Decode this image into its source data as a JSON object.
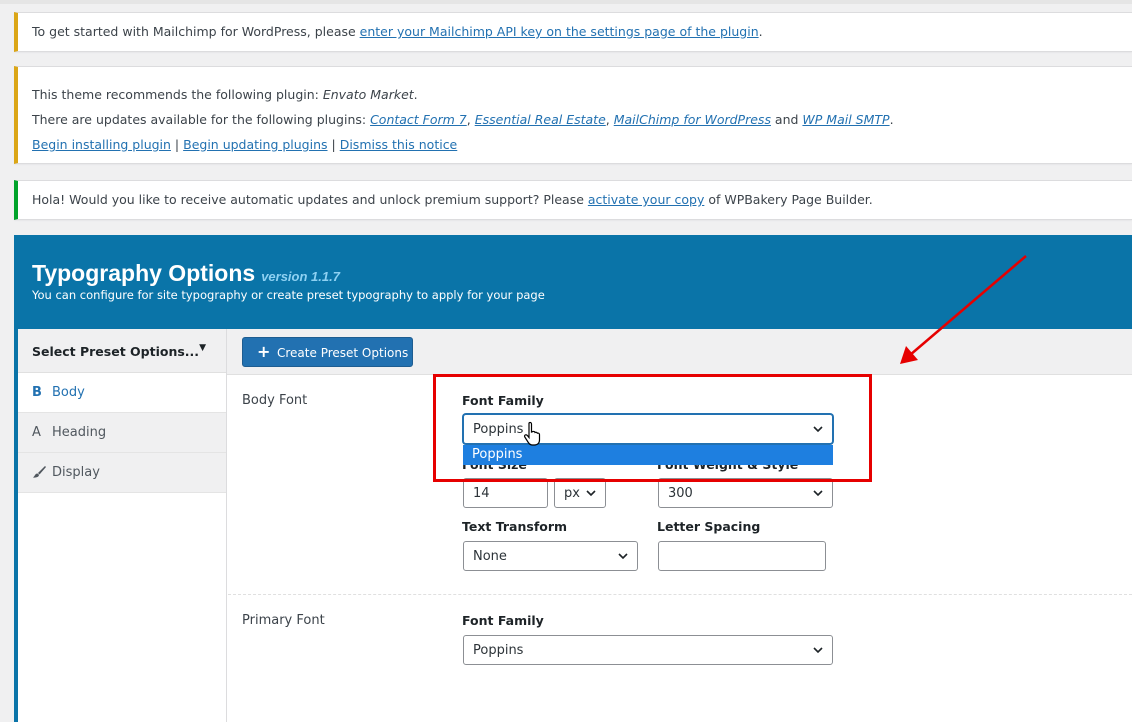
{
  "notices": {
    "mailchimp": {
      "text": "To get started with Mailchimp for WordPress, please ",
      "link": "enter your Mailchimp API key on the settings page of the plugin",
      "end": "."
    },
    "theme": {
      "line1_text": "This theme recommends the following plugin: ",
      "line1_plugin": "Envato Market",
      "line1_end": ".",
      "line2_text": "There are updates available for the following plugins: ",
      "plugins": [
        "Contact Form 7",
        "Essential Real Estate",
        "MailChimp for WordPress",
        "WP Mail SMTP"
      ],
      "sep": ", ",
      "and": " and ",
      "line2_end": ".",
      "actions": [
        "Begin installing plugin",
        "Begin updating plugins",
        "Dismiss this notice"
      ],
      "action_sep": " | "
    },
    "wpbakery": {
      "text": "Hola! Would you like to receive automatic updates and unlock premium support? Please ",
      "link": "activate your copy",
      "end": " of WPBakery Page Builder."
    }
  },
  "header": {
    "title": "Typography Options",
    "version": "version 1.1.7",
    "subtitle": "You can configure for site typography or create preset typography to apply for your page"
  },
  "sidebar": {
    "preset_select": "Select Preset Options...",
    "items": [
      {
        "icon": "B",
        "label": "Body"
      },
      {
        "icon": "A",
        "label": "Heading"
      },
      {
        "icon": "brush-icon",
        "label": "Display"
      }
    ]
  },
  "toolbar": {
    "create_label": "Create Preset Options"
  },
  "body_font": {
    "section_label": "Body Font",
    "font_family_label": "Font Family",
    "font_family_value": "Poppins",
    "dropdown_option": "Poppins",
    "font_size_label": "Font Size",
    "font_size_value": "14",
    "font_size_unit": "px",
    "font_weight_label": "Font Weight & Style",
    "font_weight_value": "300",
    "text_transform_label": "Text Transform",
    "text_transform_value": "None",
    "letter_spacing_label": "Letter Spacing",
    "letter_spacing_value": ""
  },
  "primary_font": {
    "section_label": "Primary Font",
    "font_family_label": "Font Family",
    "font_family_value": "Poppins"
  },
  "colors": {
    "accent": "#0a74a8",
    "link": "#2271b1",
    "highlight": "#e60000"
  }
}
